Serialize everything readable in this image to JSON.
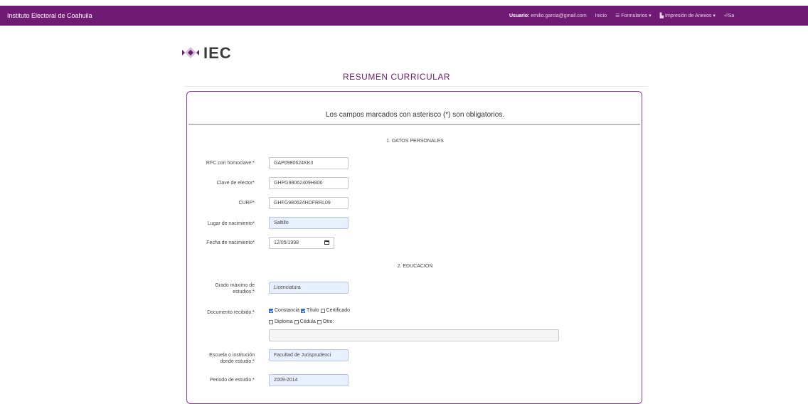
{
  "navbar": {
    "brand": "Instituto Electoral de Coahuila",
    "user_label": "Usuario:",
    "user_email": "emilio.garcia@gmail.com",
    "inicio": "Inicio",
    "formularios": "Formularios",
    "impresion": "Impresión de Anexos",
    "salir": "Sa"
  },
  "logo": {
    "text": "IEC"
  },
  "page": {
    "title": "RESUMEN CURRICULAR",
    "notice": "Los campos marcados con asterisco (*) son obligatorios."
  },
  "datos_personales": {
    "title": "1. DATOS PERSONALES",
    "rfc": {
      "label": "RFC con homoclave:*",
      "value": "GAP0980624KK3"
    },
    "clave_elector": {
      "label": "Clave de elector*",
      "value": "GHPG98062409H800"
    },
    "curp": {
      "label": "CURP*",
      "value": "GHFG980624HDFRRL09"
    },
    "lugar_nacimiento": {
      "label": "Lugar de nacimiento*",
      "value": "Saltillo"
    },
    "fecha_nacimiento": {
      "label": "Fecha de nacimiento*",
      "value": "12/05/1998"
    }
  },
  "educacion": {
    "title": "2. EDUCACIÓN",
    "grado": {
      "label_line1": "Grado máximo de",
      "label_line2": "estudios:*",
      "value": "Licenciatura"
    },
    "documento": {
      "label": "Documento recibido:*",
      "options": [
        {
          "label": "Constancia",
          "checked": true
        },
        {
          "label": "Título",
          "checked": true
        },
        {
          "label": "Certificado",
          "checked": false
        },
        {
          "label": "Diploma",
          "checked": false
        },
        {
          "label": "Cédula",
          "checked": false
        },
        {
          "label": "Otro:",
          "checked": false
        }
      ],
      "otro_value": ""
    },
    "escuela": {
      "label_line1": "Escuela o institución",
      "label_line2": "donde estudio:*",
      "value": "Facultad de Jurisprudenci"
    },
    "periodo": {
      "label": "Periodo de estudio:*",
      "value": "2009-2014"
    }
  },
  "colors": {
    "primary": "#6f1b73",
    "autofill": "#e8f0fe"
  }
}
